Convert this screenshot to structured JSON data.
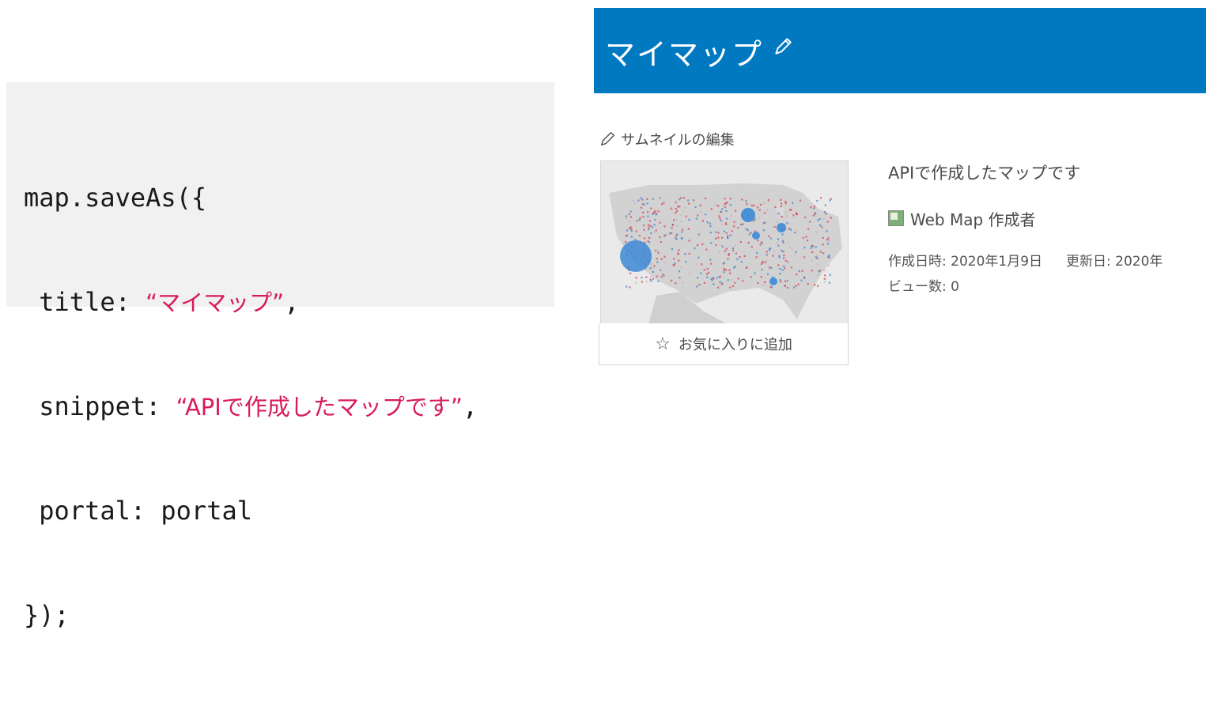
{
  "code": {
    "line1": "map.saveAs({",
    "title_key": " title: ",
    "title_value": "“マイマップ”",
    "title_comma": ",",
    "snippet_key": " snippet: ",
    "snippet_value": "“APIで作成したマップです”",
    "snippet_comma": ",",
    "portal_line": " portal: portal",
    "close_line": "});",
    "string_color": "#d81b5a"
  },
  "item_page": {
    "banner_color": "#0079c1",
    "title": "マイマップ",
    "title_edit_icon": "pencil-icon",
    "thumbnail_edit_label": "サムネイルの編集",
    "favorite_label": "お気に入りに追加",
    "favorite_icon": "star-outline-icon",
    "summary": "APIで作成したマップです",
    "owner": "Web Map 作成者",
    "created_label": "作成日時: 2020年1月9日",
    "updated_label": "更新日: 2020年",
    "views_label": "ビュー数: 0"
  }
}
